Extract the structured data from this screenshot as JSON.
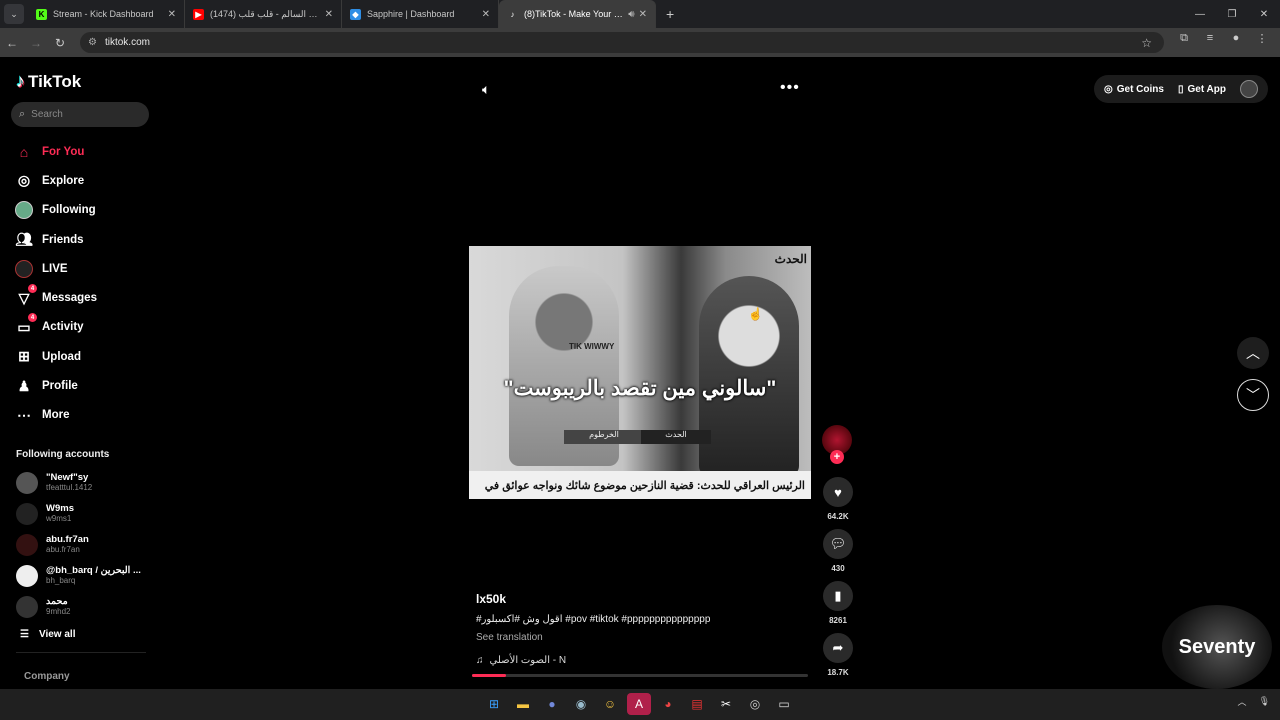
{
  "browser": {
    "tabs": [
      {
        "title": "Stream - Kick Dashboard",
        "icon": "kick-icon",
        "color": "#53fc18"
      },
      {
        "title": "محمد السالم - قلب قلب (1474)",
        "icon": "youtube-icon",
        "color": "#ff0000"
      },
      {
        "title": "Sapphire | Dashboard",
        "icon": "sapphire-icon",
        "color": "#2f8ee5"
      },
      {
        "title": "(8)TikTok - Make Your Day",
        "icon": "tiktok-icon",
        "color": "#ffffff"
      }
    ],
    "url": "tiktok.com"
  },
  "sidebar": {
    "logo": "TikTok",
    "search_placeholder": "Search",
    "items": [
      {
        "label": "For You",
        "icon": "home-icon",
        "active": true
      },
      {
        "label": "Explore",
        "icon": "compass-icon"
      },
      {
        "label": "Following",
        "icon": "following-avatar-icon"
      },
      {
        "label": "Friends",
        "icon": "friends-icon"
      },
      {
        "label": "LIVE",
        "icon": "live-icon"
      },
      {
        "label": "Messages",
        "icon": "messages-icon",
        "badge": "4"
      },
      {
        "label": "Activity",
        "icon": "activity-icon",
        "badge": "4"
      },
      {
        "label": "Upload",
        "icon": "upload-icon"
      },
      {
        "label": "Profile",
        "icon": "profile-icon"
      },
      {
        "label": "More",
        "icon": "more-icon"
      }
    ],
    "following_header": "Following accounts",
    "following": [
      {
        "name": "\"Newf\"sy",
        "user": "tfeatttul.1412"
      },
      {
        "name": "W9ms",
        "user": "w9ms1"
      },
      {
        "name": "abu.fr7an",
        "user": "abu.fr7an"
      },
      {
        "name": "@bh_barq / البحرين ...",
        "user": "bh_barq"
      },
      {
        "name": "محمد",
        "user": "9mhd2"
      }
    ],
    "view_all": "View all",
    "company": "Company"
  },
  "header": {
    "get_coins": "Get Coins",
    "get_app": "Get App"
  },
  "video": {
    "channel_tag": "الحدث",
    "caption": "\"سالوني مين تقصد بالريبوست\"",
    "watermark": "TIK WIWWY",
    "lower_bar_left": "الخرطوم",
    "lower_bar_right": "الحدث",
    "ticker": "الرئيس العراقي للحدث: قضية النازحين موضوع شائك ونواجه عوائق في",
    "author": "lx50k",
    "description": "#اقول وش #اكسبلور #pov #tiktok #ppppppppppppppp",
    "see_translation": "See translation",
    "music": "الصوت الأصلي - N",
    "progress": 0.1,
    "likes": "64.2K",
    "comments": "430",
    "saves": "8261",
    "shares": "18.7K"
  },
  "overlay": {
    "watermark_text": "Seventy"
  }
}
